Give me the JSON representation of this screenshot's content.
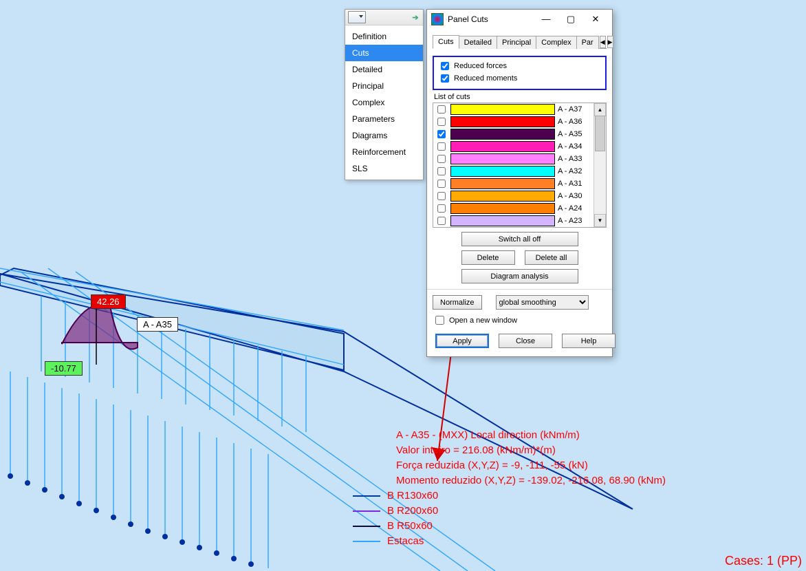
{
  "props": {
    "items": [
      "Definition",
      "Cuts",
      "Detailed",
      "Principal",
      "Complex",
      "Parameters",
      "Diagrams",
      "Reinforcement",
      "SLS"
    ],
    "selected": "Cuts"
  },
  "dialog": {
    "title": "Panel Cuts",
    "tabs": {
      "list": [
        "Cuts",
        "Detailed",
        "Principal",
        "Complex",
        "Par"
      ],
      "active": "Cuts"
    },
    "checks": {
      "reduced_forces": "Reduced forces",
      "reduced_moments": "Reduced moments"
    },
    "list_label": "List of cuts",
    "cuts": [
      {
        "label": "A - A37",
        "color": "#ffff00",
        "checked": false
      },
      {
        "label": "A - A36",
        "color": "#ff0000",
        "checked": false
      },
      {
        "label": "A - A35",
        "color": "#4d004d",
        "checked": true
      },
      {
        "label": "A - A34",
        "color": "#ff1fb5",
        "checked": false
      },
      {
        "label": "A - A33",
        "color": "#ff7fff",
        "checked": false
      },
      {
        "label": "A - A32",
        "color": "#00ffff",
        "checked": false
      },
      {
        "label": "A - A31",
        "color": "#ff7f27",
        "checked": false
      },
      {
        "label": "A - A30",
        "color": "#ffaa00",
        "checked": false
      },
      {
        "label": "A - A24",
        "color": "#ff8000",
        "checked": false
      },
      {
        "label": "A - A23",
        "color": "#d2b4ff",
        "checked": false
      }
    ],
    "switch_all_off": "Switch all off",
    "delete": "Delete",
    "delete_all": "Delete all",
    "diagram_analysis": "Diagram analysis",
    "normalize": "Normalize",
    "smoothing_option": "global smoothing",
    "open_new_window": "Open a new window",
    "apply": "Apply",
    "close": "Close",
    "help": "Help"
  },
  "viewport": {
    "value_top": "42.26",
    "value_bottom": "-10.77",
    "cut_label": "A - A35",
    "info": {
      "line1": "A - A35 - (MXX) Local direction (kNm/m)",
      "line2": "Valor inteiro = 216.08 (kNm/m)*(m)",
      "line3": "Força reduzida (X,Y,Z) = -9, -111, -55 (kN)",
      "line4": "Momento reduzido (X,Y,Z) = -139.02, -216.08, 68.90 (kNm)"
    },
    "legend": [
      {
        "label": "B R130x60",
        "color": "#003b9c"
      },
      {
        "label": "B R200x60",
        "color": "#7b2adf"
      },
      {
        "label": "B R50x60",
        "color": "#0a0a3c"
      },
      {
        "label": "Estacas",
        "color": "#2fa6ff"
      }
    ],
    "cases": "Cases: 1 (PP)"
  }
}
